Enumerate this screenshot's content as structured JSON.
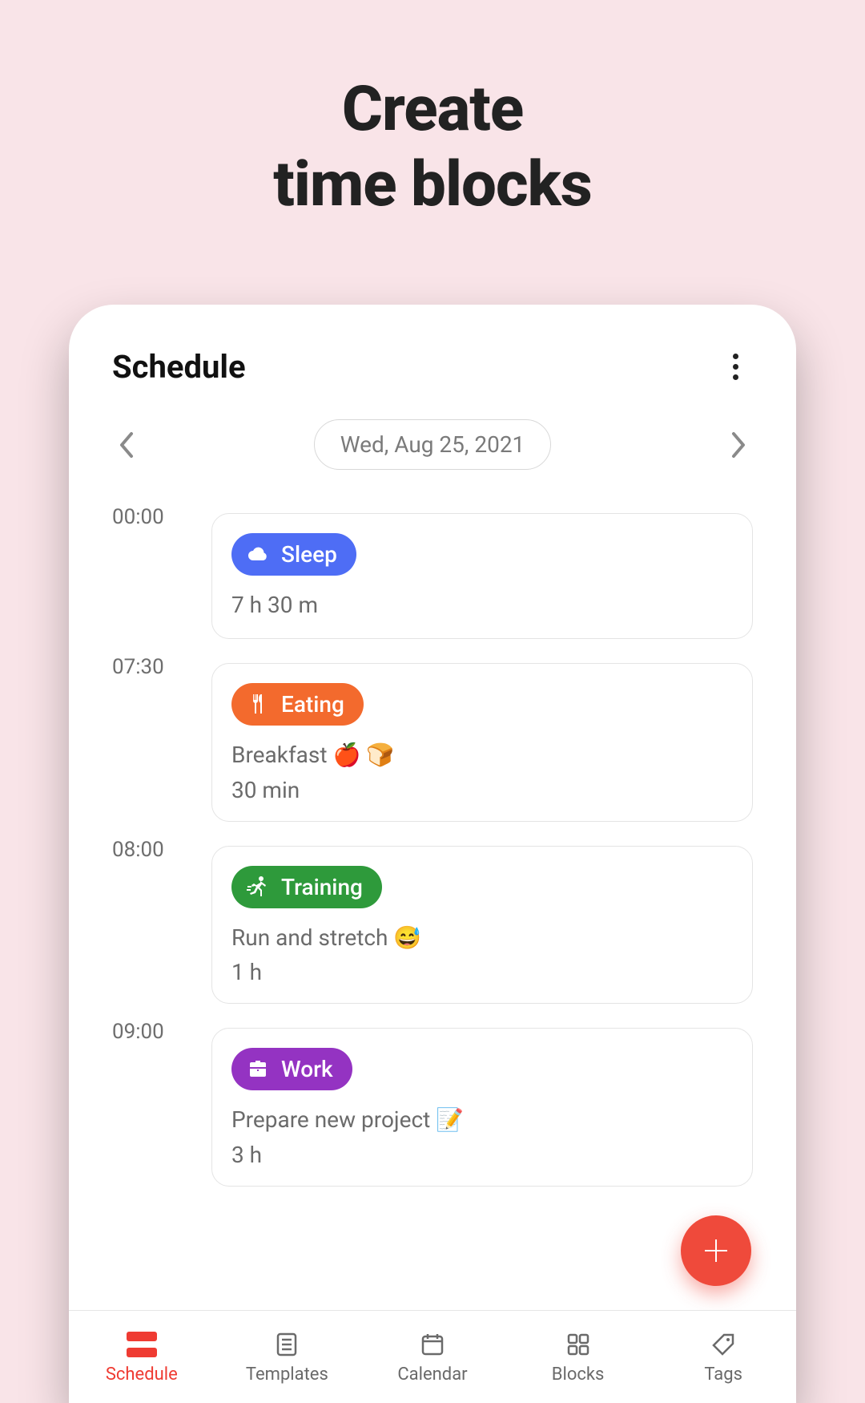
{
  "hero": {
    "line1": "Create",
    "line2": "time blocks"
  },
  "header": {
    "title": "Schedule"
  },
  "date": {
    "label": "Wed, Aug 25, 2021"
  },
  "colors": {
    "sleep": "#4e6df5",
    "eating": "#f36a2d",
    "training": "#2e9a3b",
    "work": "#9433c2",
    "accent": "#ef4a3b"
  },
  "blocks": [
    {
      "time": "00:00",
      "tag": "Sleep",
      "icon": "cloud",
      "color_key": "sleep",
      "desc": "",
      "dur": "7 h 30 m"
    },
    {
      "time": "07:30",
      "tag": "Eating",
      "icon": "utensils",
      "color_key": "eating",
      "desc": "Breakfast 🍎 🍞",
      "dur": "30 min"
    },
    {
      "time": "08:00",
      "tag": "Training",
      "icon": "running",
      "color_key": "training",
      "desc": "Run and stretch 😅",
      "dur": "1 h"
    },
    {
      "time": "09:00",
      "tag": "Work",
      "icon": "briefcase",
      "color_key": "work",
      "desc": "Prepare new project 📝",
      "dur": "3 h"
    }
  ],
  "nav": {
    "items": [
      {
        "label": "Schedule",
        "active": true
      },
      {
        "label": "Templates",
        "active": false
      },
      {
        "label": "Calendar",
        "active": false
      },
      {
        "label": "Blocks",
        "active": false
      },
      {
        "label": "Tags",
        "active": false
      }
    ]
  }
}
